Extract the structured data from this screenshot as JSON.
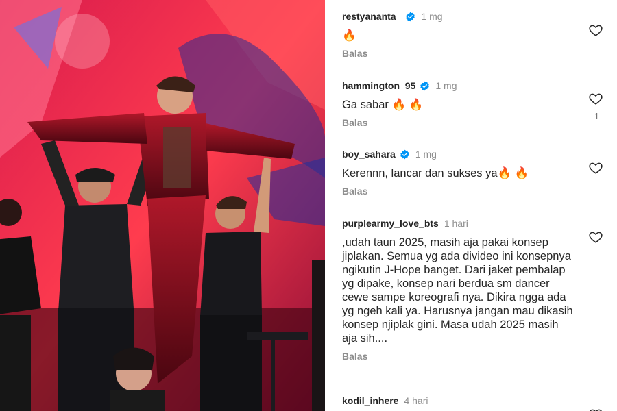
{
  "photo": {
    "alt": ""
  },
  "comments": [
    {
      "username": "restyananta_",
      "verified": true,
      "time": "1 mg",
      "text": "🔥",
      "reply_label": "Balas",
      "likes": ""
    },
    {
      "username": "hammington_95",
      "verified": true,
      "time": "1 mg",
      "text": "Ga sabar 🔥 🔥",
      "reply_label": "Balas",
      "likes": "1"
    },
    {
      "username": "boy_sahara",
      "verified": true,
      "time": "1 mg",
      "text": "Kerennn, lancar dan sukses ya🔥 🔥",
      "reply_label": "Balas",
      "likes": ""
    },
    {
      "username": "purplearmy_love_bts",
      "verified": false,
      "time": "1 hari",
      "text": ",udah taun 2025, masih aja pakai konsep jiplakan. Semua yg ada divideo ini konsepnya ngikutin J-Hope banget. Dari jaket pembalap yg dipake, konsep nari berdua sm dancer cewe sampe koreografi nya. Dikira ngga ada yg ngeh kali ya. Harusnya jangan mau dikasih konsep njiplak gini. Masa udah 2025 masih aja sih....",
      "reply_label": "Balas",
      "likes": ""
    },
    {
      "username": "kodil_inhere",
      "verified": false,
      "time": "4 hari",
      "text": "",
      "reply_label": "",
      "likes": ""
    }
  ],
  "colors": {
    "verified": "#0095f6",
    "text": "#262626",
    "muted": "#8e8e8e"
  }
}
